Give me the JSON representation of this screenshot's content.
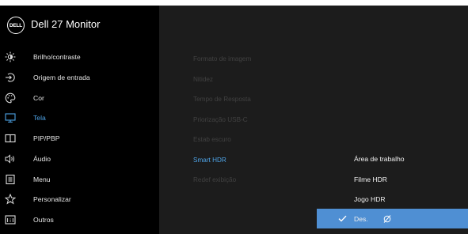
{
  "window": {
    "title": "Dell 27 Monitor",
    "logo_text": "DELL"
  },
  "menu": [
    {
      "label": "Brilho/contraste",
      "icon": "brightness-icon"
    },
    {
      "label": "Origem de entrada",
      "icon": "input-source-icon"
    },
    {
      "label": "Cor",
      "icon": "color-palette-icon"
    },
    {
      "label": "Tela",
      "icon": "display-icon",
      "active": true
    },
    {
      "label": "PIP/PBP",
      "icon": "pip-pbp-icon"
    },
    {
      "label": "Áudio",
      "icon": "audio-icon"
    },
    {
      "label": "Menu",
      "icon": "menu-icon"
    },
    {
      "label": "Personalizar",
      "icon": "star-icon"
    },
    {
      "label": "Outros",
      "icon": "others-icon"
    }
  ],
  "submenu": [
    {
      "label": "Formato de imagem"
    },
    {
      "label": "Nitidez"
    },
    {
      "label": "Tempo de Resposta"
    },
    {
      "label": "Priorização USB-C"
    },
    {
      "label": "Estab escuro"
    },
    {
      "label": "Smart HDR",
      "selected": true
    },
    {
      "label": "Redef exibição"
    }
  ],
  "options": [
    {
      "label": "Área de trabalho"
    },
    {
      "label": "Filme HDR"
    },
    {
      "label": "Jogo HDR"
    },
    {
      "label": "Des.",
      "selected": true,
      "icon": "empty-set-icon"
    }
  ],
  "colors": {
    "accent": "#4ea3e6",
    "selected_bg": "#4f8fd3",
    "panel_bg": "#1c1c1c",
    "sidebar_bg": "#000000"
  }
}
